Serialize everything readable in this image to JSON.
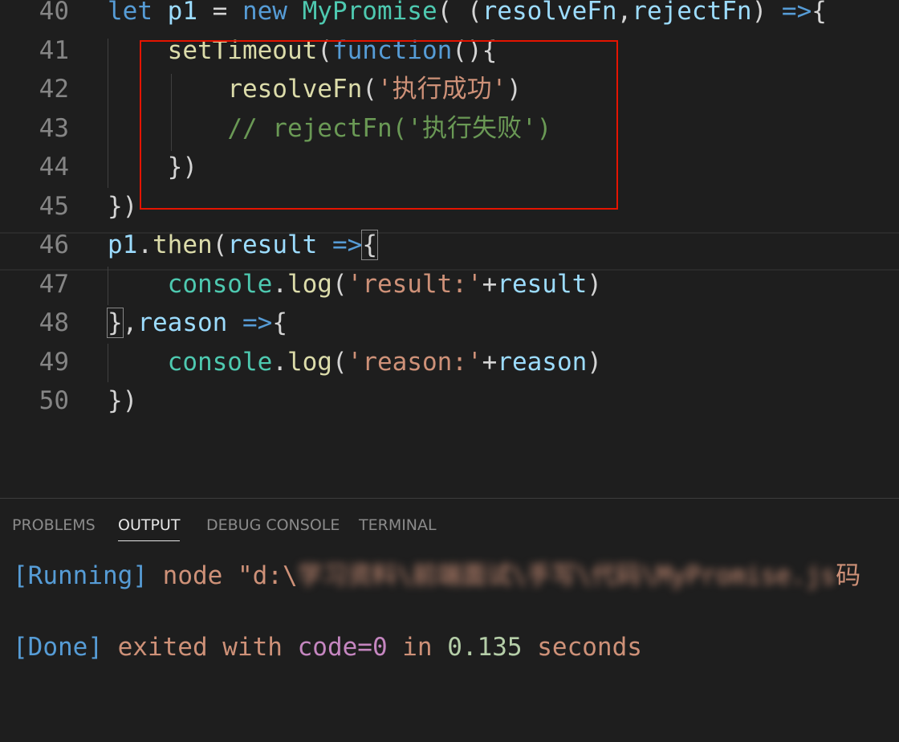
{
  "editor": {
    "lines": [
      {
        "num": "40",
        "parts": [
          {
            "t": "let ",
            "c": "kw"
          },
          {
            "t": "p1",
            "c": "var"
          },
          {
            "t": " = ",
            "c": "op"
          },
          {
            "t": "new ",
            "c": "kw"
          },
          {
            "t": "MyPromise",
            "c": "cls"
          },
          {
            "t": "( (",
            "c": "pn"
          },
          {
            "t": "resolveFn",
            "c": "var"
          },
          {
            "t": ",",
            "c": "pn"
          },
          {
            "t": "rejectFn",
            "c": "var"
          },
          {
            "t": ") ",
            "c": "pn"
          },
          {
            "t": "=>",
            "c": "kw"
          },
          {
            "t": "{",
            "c": "pn"
          }
        ]
      },
      {
        "num": "41",
        "parts": [
          {
            "t": "    ",
            "c": "pn"
          },
          {
            "t": "setTimeout",
            "c": "fn"
          },
          {
            "t": "(",
            "c": "pn"
          },
          {
            "t": "function",
            "c": "kw"
          },
          {
            "t": "(){",
            "c": "pn"
          }
        ]
      },
      {
        "num": "42",
        "parts": [
          {
            "t": "        ",
            "c": "pn"
          },
          {
            "t": "resolveFn",
            "c": "fn"
          },
          {
            "t": "(",
            "c": "pn"
          },
          {
            "t": "'执行成功'",
            "c": "str"
          },
          {
            "t": ")",
            "c": "pn"
          }
        ]
      },
      {
        "num": "43",
        "parts": [
          {
            "t": "        ",
            "c": "pn"
          },
          {
            "t": "// rejectFn('执行失败')",
            "c": "cmt"
          }
        ]
      },
      {
        "num": "44",
        "parts": [
          {
            "t": "    ",
            "c": "pn"
          },
          {
            "t": "})",
            "c": "pn"
          }
        ]
      },
      {
        "num": "45",
        "parts": [
          {
            "t": "})",
            "c": "pn"
          }
        ]
      },
      {
        "num": "46",
        "parts": [
          {
            "t": "p1",
            "c": "var"
          },
          {
            "t": ".",
            "c": "pn"
          },
          {
            "t": "then",
            "c": "fn"
          },
          {
            "t": "(",
            "c": "pn"
          },
          {
            "t": "result",
            "c": "var"
          },
          {
            "t": " ",
            "c": "pn"
          },
          {
            "t": "=>",
            "c": "kw"
          },
          {
            "t": "{",
            "c": "pn hl"
          }
        ]
      },
      {
        "num": "47",
        "parts": [
          {
            "t": "    ",
            "c": "pn"
          },
          {
            "t": "console",
            "c": "cls"
          },
          {
            "t": ".",
            "c": "pn"
          },
          {
            "t": "log",
            "c": "fn"
          },
          {
            "t": "(",
            "c": "pn"
          },
          {
            "t": "'result:'",
            "c": "str"
          },
          {
            "t": "+",
            "c": "op"
          },
          {
            "t": "result",
            "c": "var"
          },
          {
            "t": ")",
            "c": "pn"
          }
        ]
      },
      {
        "num": "48",
        "parts": [
          {
            "t": "}",
            "c": "pn hl"
          },
          {
            "t": ",",
            "c": "pn"
          },
          {
            "t": "reason",
            "c": "var"
          },
          {
            "t": " ",
            "c": "pn"
          },
          {
            "t": "=>",
            "c": "kw"
          },
          {
            "t": "{",
            "c": "pn"
          }
        ]
      },
      {
        "num": "49",
        "parts": [
          {
            "t": "    ",
            "c": "pn"
          },
          {
            "t": "console",
            "c": "cls"
          },
          {
            "t": ".",
            "c": "pn"
          },
          {
            "t": "log",
            "c": "fn"
          },
          {
            "t": "(",
            "c": "pn"
          },
          {
            "t": "'reason:'",
            "c": "str"
          },
          {
            "t": "+",
            "c": "op"
          },
          {
            "t": "reason",
            "c": "var"
          },
          {
            "t": ")",
            "c": "pn"
          }
        ]
      },
      {
        "num": "50",
        "parts": [
          {
            "t": "})",
            "c": "pn"
          }
        ]
      }
    ]
  },
  "panel": {
    "tabs": [
      "PROBLEMS",
      "OUTPUT",
      "DEBUG CONSOLE",
      "TERMINAL"
    ],
    "active_tab": "OUTPUT",
    "output": {
      "running_tag": "[Running]",
      "running_cmd": "node \"d:\\",
      "running_redacted": "学习资料\\前端面试\\手写\\代码\\MyPromise.js",
      "running_tail": "码",
      "done_tag": "[Done]",
      "done_text_1": " exited with ",
      "done_code": "code=0",
      "done_text_2": " in ",
      "done_time": "0.135",
      "done_text_3": " seconds"
    }
  },
  "colors": {
    "background": "#1e1e1e",
    "highlight_box": "#e51400"
  }
}
